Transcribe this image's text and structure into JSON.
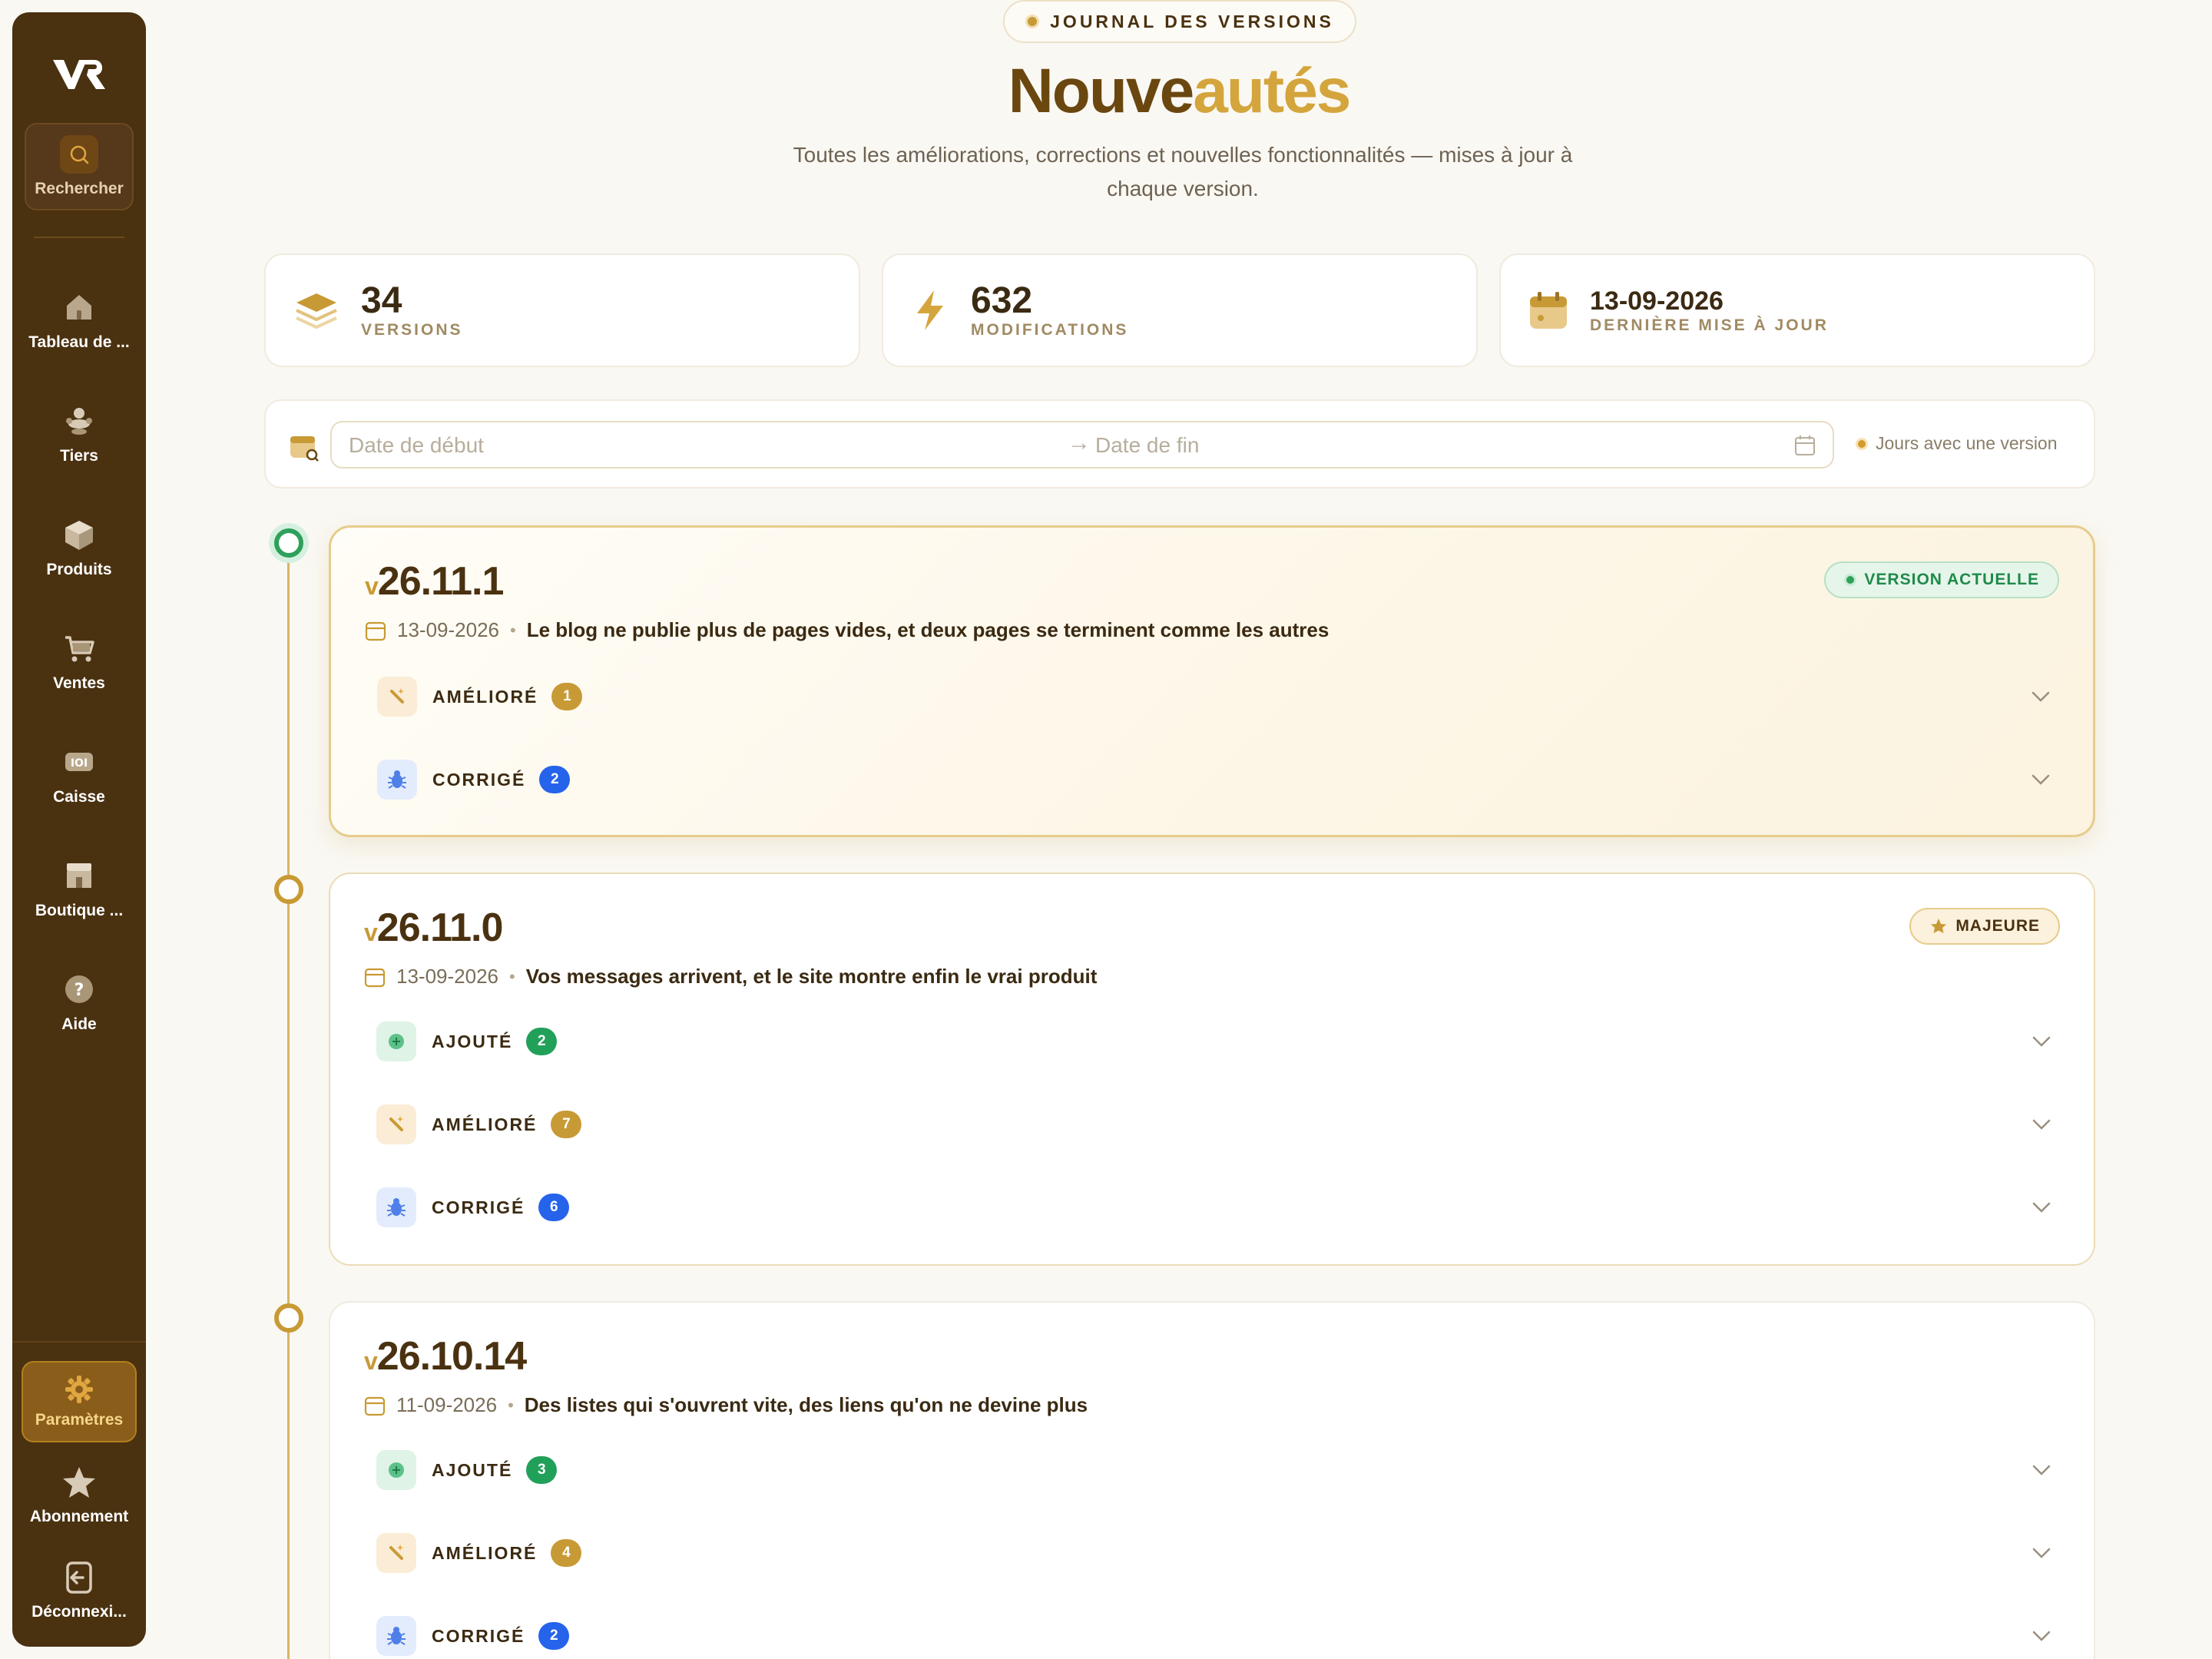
{
  "sidebar": {
    "search_label": "Rechercher",
    "items": [
      {
        "label": "Tableau de ...",
        "icon": "home-icon"
      },
      {
        "label": "Tiers",
        "icon": "users-icon"
      },
      {
        "label": "Produits",
        "icon": "box-icon"
      },
      {
        "label": "Ventes",
        "icon": "cart-icon"
      },
      {
        "label": "Caisse",
        "icon": "cash-register-icon"
      },
      {
        "label": "Boutique ...",
        "icon": "store-icon"
      },
      {
        "label": "Aide",
        "icon": "help-icon"
      }
    ],
    "settings_label": "Paramètres",
    "subscription_label": "Abonnement",
    "logout_label": "Déconnexi..."
  },
  "header": {
    "pill": "JOURNAL DES VERSIONS",
    "title_part1": "Nouve",
    "title_part2": "autés",
    "subtitle": "Toutes les améliorations, corrections et nouvelles fonctionnalités — mises à jour à chaque version."
  },
  "stats": [
    {
      "value": "34",
      "label": "VERSIONS",
      "icon": "layers-icon"
    },
    {
      "value": "632",
      "label": "MODIFICATIONS",
      "icon": "bolt-icon"
    },
    {
      "value": "13-09-2026",
      "label": "DERNIÈRE MISE À JOUR",
      "icon": "calendar-icon"
    }
  ],
  "filter": {
    "start_placeholder": "Date de début",
    "arrow": "→",
    "end_placeholder": "Date de fin",
    "legend": "Jours avec une version"
  },
  "versions": [
    {
      "prefix": "v",
      "number": "26.11.1",
      "date": "13-09-2026",
      "description": "Le blog ne publie plus de pages vides, et deux pages se terminent comme les autres",
      "badge": "VERSION ACTUELLE",
      "changes": [
        {
          "label": "AMÉLIORÉ",
          "count": "1"
        },
        {
          "label": "CORRIGÉ",
          "count": "2"
        }
      ]
    },
    {
      "prefix": "v",
      "number": "26.11.0",
      "date": "13-09-2026",
      "description": "Vos messages arrivent, et le site montre enfin le vrai produit",
      "badge": "MAJEURE",
      "changes": [
        {
          "label": "AJOUTÉ",
          "count": "2"
        },
        {
          "label": "AMÉLIORÉ",
          "count": "7"
        },
        {
          "label": "CORRIGÉ",
          "count": "6"
        }
      ]
    },
    {
      "prefix": "v",
      "number": "26.10.14",
      "date": "11-09-2026",
      "description": "Des listes qui s'ouvrent vite, des liens qu'on ne devine plus",
      "changes": [
        {
          "label": "AJOUTÉ",
          "count": "3"
        },
        {
          "label": "AMÉLIORÉ",
          "count": "4"
        },
        {
          "label": "CORRIGÉ",
          "count": "2"
        }
      ]
    }
  ],
  "colors": {
    "sidebar_bg": "#4a3110",
    "accent_gold": "#c89a35",
    "improved": "#c89a35",
    "fixed": "#2563eb",
    "added": "#21a05a",
    "current_green": "#2ea05a"
  }
}
